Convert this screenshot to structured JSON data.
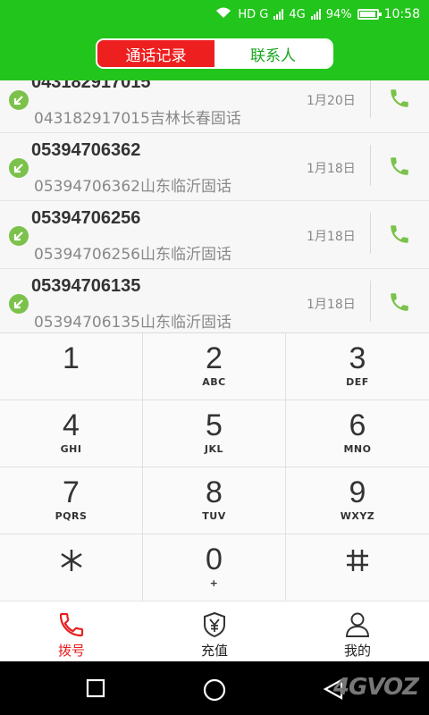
{
  "status_bar": {
    "network_hd": "HD G",
    "network_4g": "4G",
    "battery": "94%",
    "time": "10:58"
  },
  "tabs": [
    {
      "label": "通话记录",
      "active": true
    },
    {
      "label": "联系人",
      "active": false
    }
  ],
  "call_log": [
    {
      "number": "043182917015",
      "location": "043182917015吉林长春固话",
      "date": "1月20日"
    },
    {
      "number": "05394706362",
      "location": "05394706362山东临沂固话",
      "date": "1月18日"
    },
    {
      "number": "05394706256",
      "location": "05394706256山东临沂固话",
      "date": "1月18日"
    },
    {
      "number": "05394706135",
      "location": "05394706135山东临沂固话",
      "date": "1月18日"
    }
  ],
  "keypad": [
    {
      "digit": "1",
      "letters": ""
    },
    {
      "digit": "2",
      "letters": "ABC"
    },
    {
      "digit": "3",
      "letters": "DEF"
    },
    {
      "digit": "4",
      "letters": "GHI"
    },
    {
      "digit": "5",
      "letters": "JKL"
    },
    {
      "digit": "6",
      "letters": "MNO"
    },
    {
      "digit": "7",
      "letters": "PQRS"
    },
    {
      "digit": "8",
      "letters": "TUV"
    },
    {
      "digit": "9",
      "letters": "WXYZ"
    },
    {
      "digit": "⁎",
      "letters": ""
    },
    {
      "digit": "0",
      "letters": "+"
    },
    {
      "digit": "#",
      "letters": ""
    }
  ],
  "bottom_tabs": [
    {
      "label": "拨号",
      "icon": "phone-icon",
      "active": true
    },
    {
      "label": "充值",
      "icon": "yuan-shield-icon",
      "active": false
    },
    {
      "label": "我的",
      "icon": "user-icon",
      "active": false
    }
  ],
  "watermark": "4GVOZ",
  "colors": {
    "header_green": "#22c51b",
    "active_red": "#ee1f1f",
    "call_green": "#7bc24a"
  }
}
